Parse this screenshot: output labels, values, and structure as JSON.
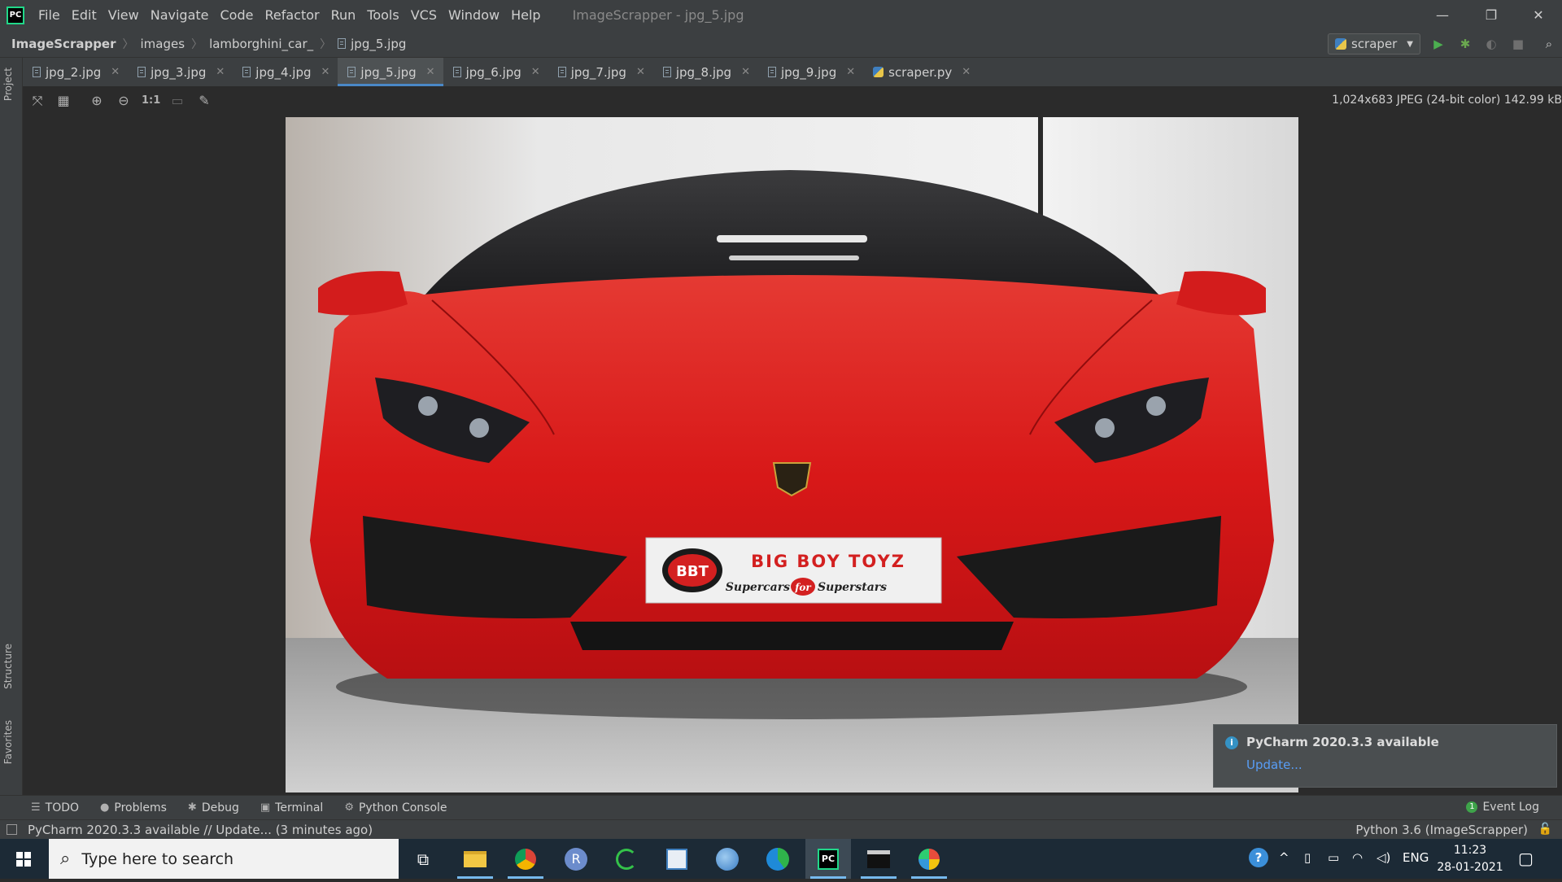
{
  "window": {
    "title": "ImageScrapper - jpg_5.jpg",
    "logo": "PC",
    "controls": {
      "minimize": "—",
      "restore": "❐",
      "close": "✕"
    }
  },
  "menu": [
    "File",
    "Edit",
    "View",
    "Navigate",
    "Code",
    "Refactor",
    "Run",
    "Tools",
    "VCS",
    "Window",
    "Help"
  ],
  "breadcrumb": [
    "ImageScrapper",
    "images",
    "lamborghini_car_",
    "jpg_5.jpg"
  ],
  "run_config": {
    "label": "scraper"
  },
  "tabs": [
    {
      "label": "jpg_2.jpg",
      "active": false
    },
    {
      "label": "jpg_3.jpg",
      "active": false
    },
    {
      "label": "jpg_4.jpg",
      "active": false
    },
    {
      "label": "jpg_5.jpg",
      "active": true
    },
    {
      "label": "jpg_6.jpg",
      "active": false
    },
    {
      "label": "jpg_7.jpg",
      "active": false
    },
    {
      "label": "jpg_8.jpg",
      "active": false
    },
    {
      "label": "jpg_9.jpg",
      "active": false
    },
    {
      "label": "scraper.py",
      "active": false
    }
  ],
  "left_strip": {
    "project": "Project",
    "structure": "Structure",
    "favorites": "Favorites"
  },
  "image_info": "1,024x683 JPEG (24-bit color) 142.99 kB",
  "image_toolbar": {
    "actual_size": "1:1"
  },
  "plate": {
    "logo": "BBT",
    "brand": "BIG BOY TOYZ",
    "tagline_a": "Supercars",
    "tagline_for": "for",
    "tagline_b": "Superstars"
  },
  "notification": {
    "title": "PyCharm 2020.3.3 available",
    "link": "Update..."
  },
  "tool_windows": [
    "TODO",
    "Problems",
    "Debug",
    "Terminal",
    "Python Console"
  ],
  "event_log": {
    "label": "Event Log",
    "count": "1"
  },
  "status": {
    "message": "PyCharm 2020.3.3 available // Update... (3 minutes ago)",
    "interpreter": "Python 3.6 (ImageScrapper)"
  },
  "taskbar": {
    "search_placeholder": "Type here to search",
    "language": "ENG",
    "time": "11:23",
    "date": "28-01-2021"
  },
  "colors": {
    "accent": "#4a88c7",
    "car": "#d81818",
    "ide_bg": "#2b2b2b",
    "panel": "#3c3f41"
  }
}
